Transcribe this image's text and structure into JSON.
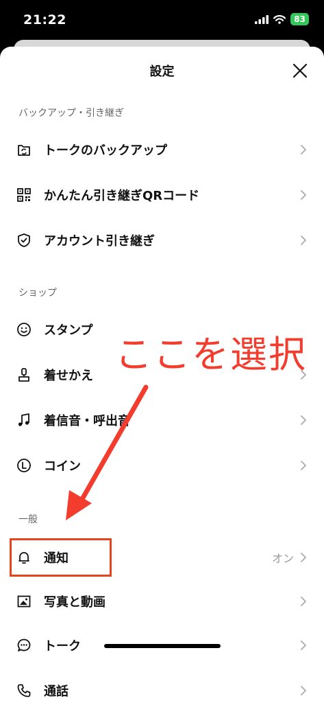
{
  "status": {
    "time": "21:22",
    "battery": "83"
  },
  "sheet": {
    "title": "設定"
  },
  "sections": {
    "backup": {
      "header": "バックアップ・引き継ぎ"
    },
    "shop": {
      "header": "ショップ"
    },
    "general": {
      "header": "一般"
    }
  },
  "items": {
    "talk_backup": "トークのバックアップ",
    "qr_transfer": "かんたん引き継ぎQRコード",
    "account_transfer": "アカウント引き継ぎ",
    "stamps": "スタンプ",
    "themes": "着せかえ",
    "ringtones": "着信音・呼出音",
    "coins": "コイン",
    "notifications": "通知",
    "notifications_value": "オン",
    "photos_videos": "写真と動画",
    "talk": "トーク",
    "calls": "通話"
  },
  "annotation": {
    "text": "ここを選択",
    "color": "#f23d2e"
  }
}
